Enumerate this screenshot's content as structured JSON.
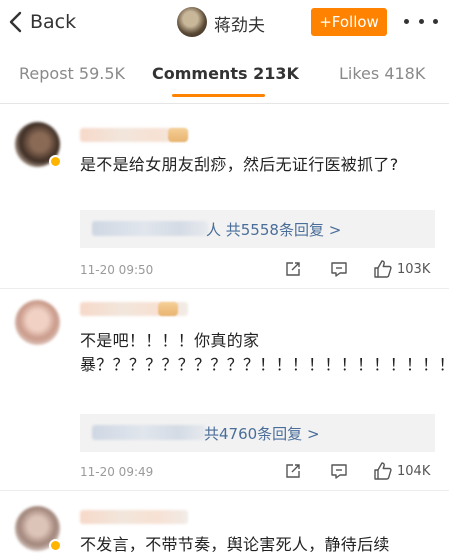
{
  "header": {
    "back_label": "Back",
    "user_name": "蒋劲夫",
    "follow_label": "+Follow"
  },
  "tabs": [
    {
      "label": "Repost 59.5K",
      "active": false
    },
    {
      "label": "Comments 213K",
      "active": true
    },
    {
      "label": "Likes 418K",
      "active": false
    }
  ],
  "colors": {
    "accent": "#ff8200",
    "link": "#4a6e9a",
    "muted": "#9a9a9a"
  },
  "comments": [
    {
      "text": "是不是给女朋友刮痧，然后无证行医被抓了?",
      "reply_link": "人 共5558条回复 >",
      "time": "11-20 09:50",
      "likes": "103K",
      "icons": [
        "share-icon",
        "comment-icon",
        "thumbs-up-icon"
      ]
    },
    {
      "text": "不是吧！！！！你真的家暴？？？？？？？？？？！！！！！！！！！！！！",
      "reply_link": "共4760条回复 >",
      "time": "11-20 09:49",
      "likes": "104K",
      "icons": [
        "share-icon",
        "comment-icon",
        "thumbs-up-icon"
      ]
    },
    {
      "text": "不发言，不带节奏，舆论害死人，静待后续"
    }
  ]
}
